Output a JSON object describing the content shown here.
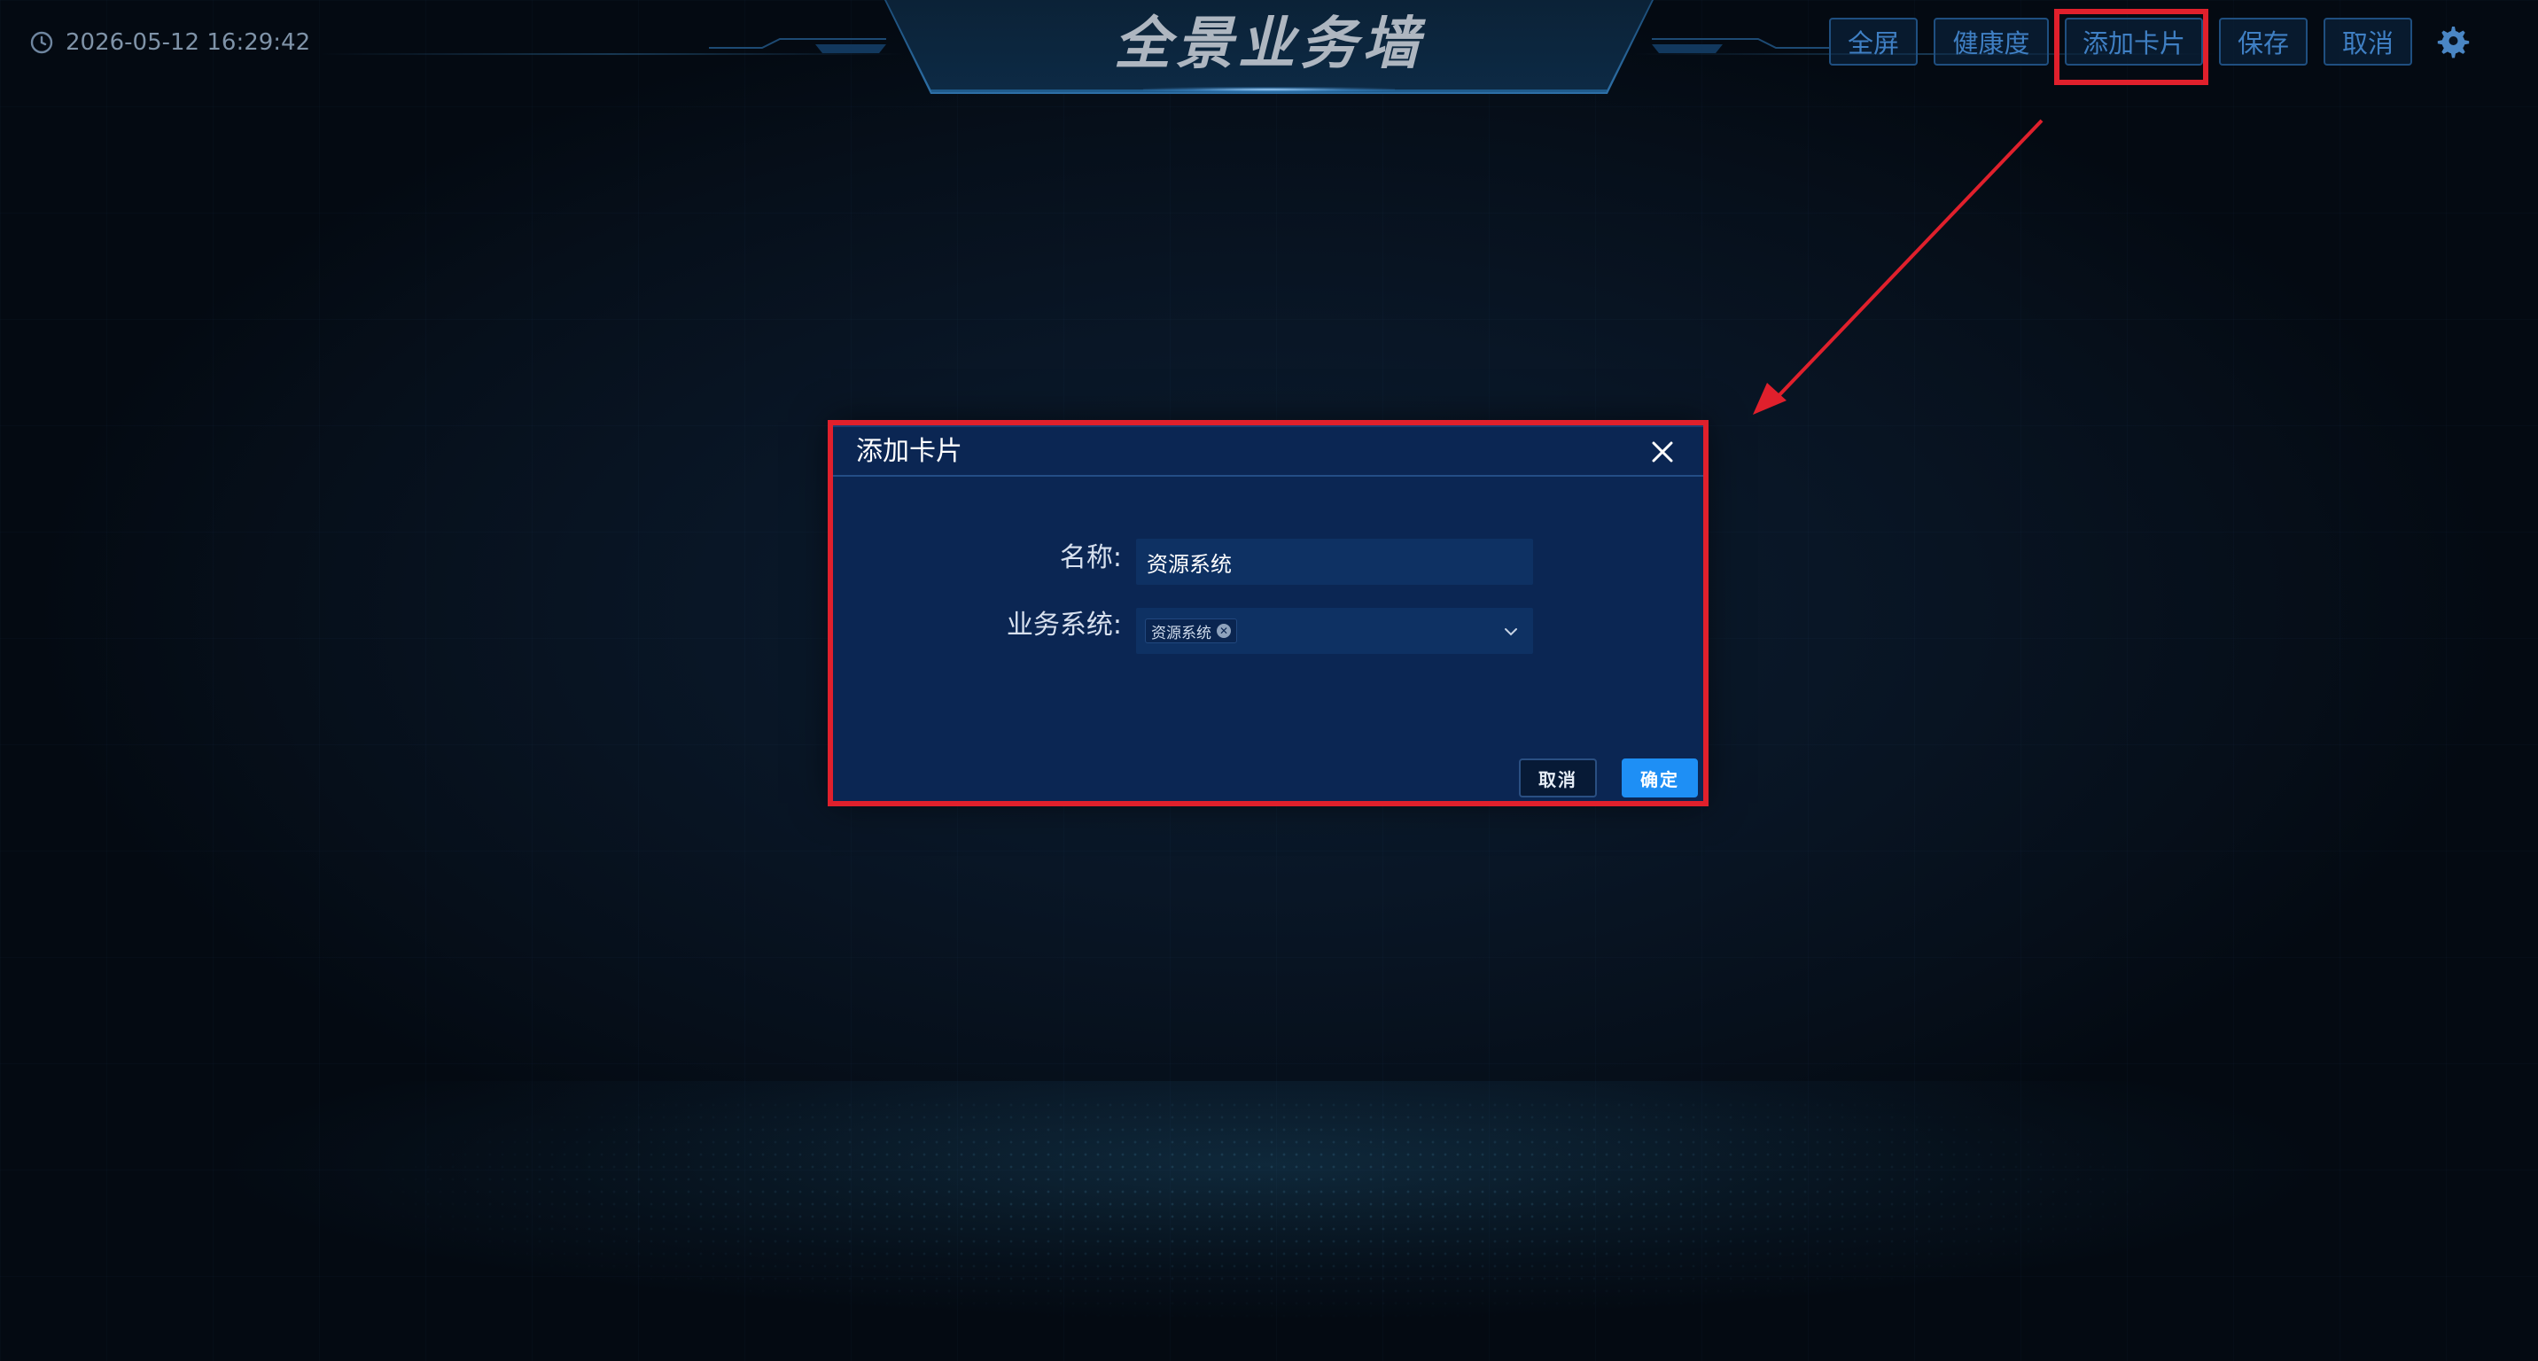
{
  "header": {
    "datetime": "2026-05-12 16:29:42",
    "title": "全景业务墙",
    "toolbar": {
      "fullscreen_label": "全屏",
      "health_label": "健康度",
      "add_card_label": "添加卡片",
      "save_label": "保存",
      "cancel_label": "取消"
    },
    "settings_icon": "gear-icon"
  },
  "dialog": {
    "title": "添加卡片",
    "fields": {
      "name_label": "名称:",
      "name_value": "资源系统",
      "system_label": "业务系统:",
      "system_selected": [
        "资源系统"
      ]
    },
    "buttons": {
      "cancel_label": "取消",
      "ok_label": "确定"
    }
  },
  "colors": {
    "background": "#07121f",
    "dialog_bg": "#0b2653",
    "input_bg": "#0e3163",
    "primary": "#1e8ff5",
    "toolbar_text": "#3f7fc3",
    "annotation": "#e0202c"
  }
}
